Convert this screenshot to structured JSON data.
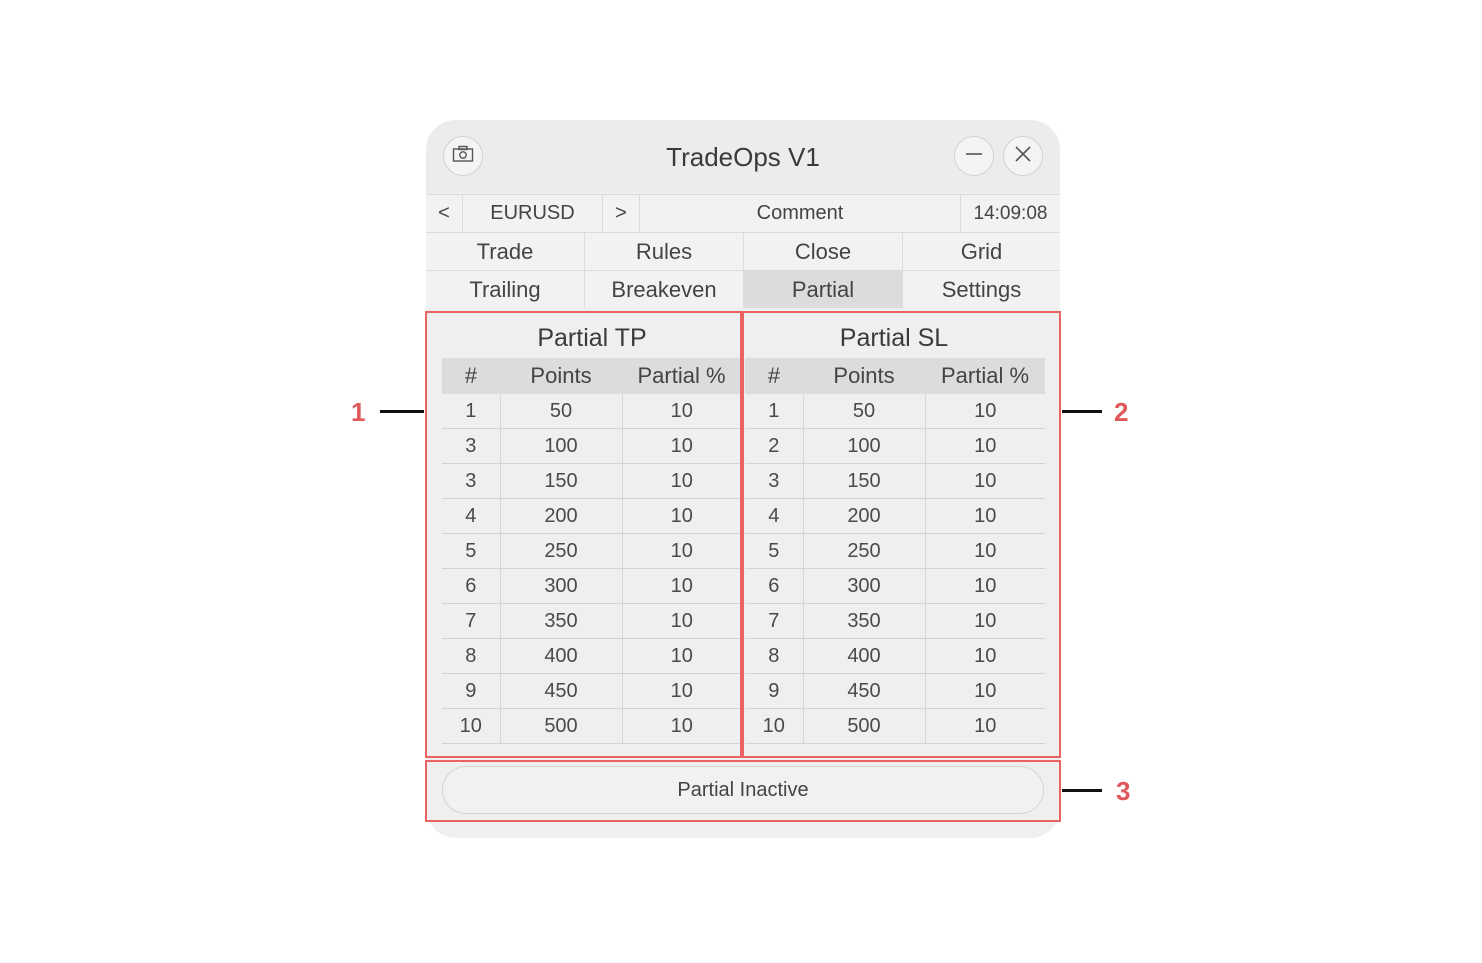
{
  "window": {
    "title": "TradeOps V1"
  },
  "symbol_bar": {
    "prev": "<",
    "symbol": "EURUSD",
    "next": ">",
    "comment": "Comment",
    "time": "14:09:08"
  },
  "tabs": {
    "row1": [
      "Trade",
      "Rules",
      "Close",
      "Grid"
    ],
    "row2": [
      "Trailing",
      "Breakeven",
      "Partial",
      "Settings"
    ],
    "active": "Partial"
  },
  "partial_tp": {
    "title": "Partial TP",
    "columns": [
      "#",
      "Points",
      "Partial %"
    ],
    "rows": [
      [
        "1",
        "50",
        "10"
      ],
      [
        "3",
        "100",
        "10"
      ],
      [
        "3",
        "150",
        "10"
      ],
      [
        "4",
        "200",
        "10"
      ],
      [
        "5",
        "250",
        "10"
      ],
      [
        "6",
        "300",
        "10"
      ],
      [
        "7",
        "350",
        "10"
      ],
      [
        "8",
        "400",
        "10"
      ],
      [
        "9",
        "450",
        "10"
      ],
      [
        "10",
        "500",
        "10"
      ]
    ]
  },
  "partial_sl": {
    "title": "Partial SL",
    "columns": [
      "#",
      "Points",
      "Partial %"
    ],
    "rows": [
      [
        "1",
        "50",
        "10"
      ],
      [
        "2",
        "100",
        "10"
      ],
      [
        "3",
        "150",
        "10"
      ],
      [
        "4",
        "200",
        "10"
      ],
      [
        "5",
        "250",
        "10"
      ],
      [
        "6",
        "300",
        "10"
      ],
      [
        "7",
        "350",
        "10"
      ],
      [
        "8",
        "400",
        "10"
      ],
      [
        "9",
        "450",
        "10"
      ],
      [
        "10",
        "500",
        "10"
      ]
    ]
  },
  "status_button": {
    "label": "Partial Inactive"
  },
  "callouts": [
    "1",
    "2",
    "3"
  ],
  "colors": {
    "highlight": "#ea6363",
    "active_tab": "#dcdcdc",
    "callout_number": "#e0595a"
  }
}
